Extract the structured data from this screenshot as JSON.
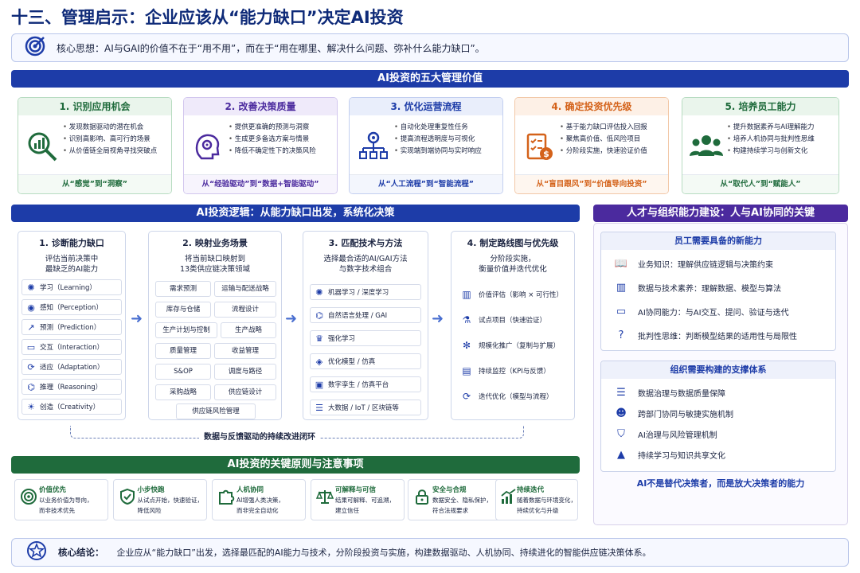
{
  "title": "十三、管理启示：企业应该从“能力缺口”决定AI投资",
  "core_idea": "核心思想：AI与GAI的价值不在于“用不用”，而在于“用在哪里、解决什么问题、弥补什么能力缺口”。",
  "values_title": "AI投资的五大管理价值",
  "values": [
    {
      "title": "1. 识别应用机会",
      "bullets": [
        "发现数据驱动的潜在机会",
        "识别高影响、高可行的场景",
        "从价值链全局视角寻找突破点"
      ],
      "footer": "从“感觉”到“洞察”",
      "color": "#1f6b3c",
      "bg": "#eaf5ec"
    },
    {
      "title": "2. 改善决策质量",
      "bullets": [
        "提供更准确的预测与洞察",
        "生成更多备选方案与情景",
        "降低不确定性下的决策风险"
      ],
      "footer": "从“经验驱动”到“数据+智能驱动”",
      "color": "#4b2a9e",
      "bg": "#efeafa"
    },
    {
      "title": "3. 优化运营流程",
      "bullets": [
        "自动化处理重复性任务",
        "提高流程透明度与可视化",
        "实现端到端协同与实时响应"
      ],
      "footer": "从“人工流程”到“智能流程”",
      "color": "#1d3ca8",
      "bg": "#e9eefb"
    },
    {
      "title": "4. 确定投资优先级",
      "bullets": [
        "基于能力缺口评估投入回报",
        "聚焦高价值、低风险项目",
        "分阶段实施，快速验证价值"
      ],
      "footer": "从“盲目跟风”到“价值导向投资”",
      "color": "#d4621a",
      "bg": "#fdf0e6"
    },
    {
      "title": "5. 培养员工能力",
      "bullets": [
        "提升数据素养与AI理解能力",
        "培养人机协同与批判性思维",
        "构建持续学习与创新文化"
      ],
      "footer": "从“取代人”到“赋能人”",
      "color": "#1f6b3c",
      "bg": "#eaf5ec"
    }
  ],
  "logic_title": "AI投资逻辑：从能力缺口出发，系统化决策",
  "step1": {
    "title": "1. 诊断能力缺口",
    "sub1": "评估当前决策中",
    "sub2": "最缺乏的AI能力",
    "items": [
      "学习（Learning）",
      "感知（Perception）",
      "预测（Prediction）",
      "交互（Interaction）",
      "适应（Adaptation）",
      "推理（Reasoning）",
      "创造（Creativity）"
    ]
  },
  "step2": {
    "title": "2. 映射业务场景",
    "sub1": "将当前缺口映射到",
    "sub2": "13类供应链决策领域",
    "tags": [
      "需求预测",
      "运输与配送战略",
      "库存与仓储",
      "流程设计",
      "生产计划与控制",
      "生产战略",
      "质量管理",
      "收益管理",
      "S&OP",
      "调度与路径",
      "采购战略",
      "供应链设计",
      "供应链风险管理"
    ]
  },
  "step3": {
    "title": "3. 匹配技术与方法",
    "sub1": "选择最合适的AI/GAI方法",
    "sub2": "与数字技术组合",
    "items": [
      "机器学习 / 深度学习",
      "自然语言处理 / GAI",
      "强化学习",
      "优化模型 / 仿真",
      "数字孪生 / 仿真平台",
      "大数据 / IoT / 区块链等"
    ]
  },
  "step4": {
    "title": "4. 制定路线图与优先级",
    "sub1": "分阶段实施，",
    "sub2": "衡量价值并迭代优化",
    "items": [
      "价值评估（影响 × 可行性）",
      "试点项目（快速验证）",
      "规模化推广（复制与扩展）",
      "持续监控（KPI与反馈）",
      "迭代优化（模型与流程）"
    ]
  },
  "loop_text": "数据与反馈驱动的持续改进闭环",
  "principles_title": "AI投资的关键原则与注意事项",
  "principles": [
    {
      "title": "价值优先",
      "desc1": "以业务价值为导向，",
      "desc2": "而非技术优先"
    },
    {
      "title": "小步快跑",
      "desc1": "从试点开始，快速验证，",
      "desc2": "降低风险"
    },
    {
      "title": "人机协同",
      "desc1": "AI增强人类决策，",
      "desc2": "而非完全自动化"
    },
    {
      "title": "可解释与可信",
      "desc1": "结果可解释、可追溯，",
      "desc2": "建立信任"
    },
    {
      "title": "安全与合规",
      "desc1": "数据安全、隐私保护，",
      "desc2": "符合法规要求"
    },
    {
      "title": "持续迭代",
      "desc1": "随着数据与环境变化，",
      "desc2": "持续优化与升级"
    }
  ],
  "talent_title": "人才与组织能力建设：人与AI协同的关键",
  "skills_title": "员工需要具备的新能力",
  "skills": [
    "业务知识：理解供应链逻辑与决策约束",
    "数据与技术素养：理解数据、模型与算法",
    "AI协同能力：与AI交互、提问、验证与迭代",
    "批判性思维：判断模型结果的适用性与局限性"
  ],
  "org_title": "组织需要构建的支撑体系",
  "org": [
    "数据治理与数据质量保障",
    "跨部门协同与敏捷实施机制",
    "AI治理与风险管理机制",
    "持续学习与知识共享文化"
  ],
  "talent_footer": "AI不是替代决策者，而是放大决策者的能力",
  "conclusion_label": "核心结论：",
  "conclusion": "企业应从“能力缺口”出发，选择最匹配的AI能力与技术，分阶段投资与实施，构建数据驱动、人机协同、持续进化的智能供应链决策体系。"
}
